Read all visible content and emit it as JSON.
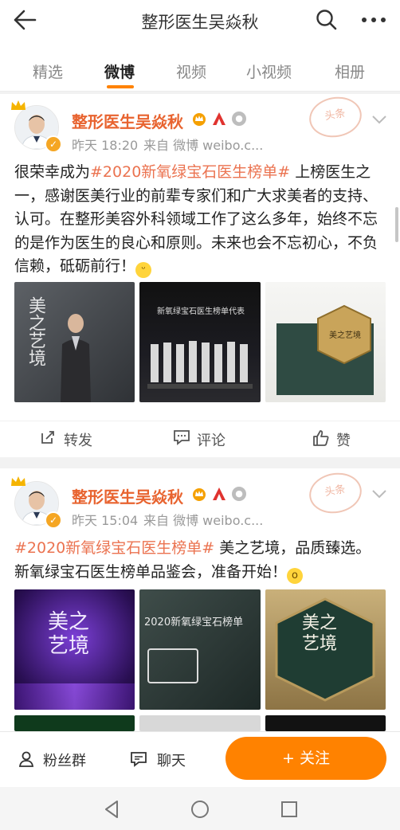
{
  "header": {
    "title": "整形医生吴焱秋"
  },
  "tabs": [
    {
      "label": "精选"
    },
    {
      "label": "微博"
    },
    {
      "label": "视频"
    },
    {
      "label": "小视频"
    },
    {
      "label": "相册"
    }
  ],
  "posts": [
    {
      "author": "整形医生吴焱秋",
      "time": "昨天 18:20",
      "source": "来自 微博 weibo.c...",
      "stamp": "头条",
      "hashtag": "#2020新氧绿宝石医生榜单#",
      "text_before": "很荣幸成为",
      "text_after": " 上榜医生之一，感谢医美行业的前辈专家们和广大求美者的支持、认可。在整形美容外科领域工作了这么多年，始终不忘的是作为医生的良心和原则。未来也会不忘初心，不负信赖，砥砺前行！",
      "photos": [
        {
          "caption": "美之艺境"
        },
        {
          "caption": "新氧绿宝石医生榜单代表"
        },
        {
          "caption": "美之艺境"
        }
      ],
      "actions": {
        "repost": "转发",
        "comment": "评论",
        "like": "赞"
      }
    },
    {
      "author": "整形医生吴焱秋",
      "time": "昨天 15:04",
      "source": "来自 微博 weibo.c...",
      "stamp": "头条",
      "hashtag": "#2020新氧绿宝石医生榜单#",
      "text_after": " 美之艺境，品质臻选。新氧绿宝石医生榜单品鉴会，准备开始！",
      "photos": [
        {
          "caption": "美之艺境"
        },
        {
          "caption": "2020新氧绿宝石榜单"
        },
        {
          "caption": "美之艺境"
        }
      ]
    }
  ],
  "bottom": {
    "fans_group": "粉丝群",
    "chat": "聊天",
    "follow": "+ 关注"
  },
  "colors": {
    "accent": "#ff8200",
    "hashtag": "#eb7350",
    "name": "#e8632f"
  }
}
